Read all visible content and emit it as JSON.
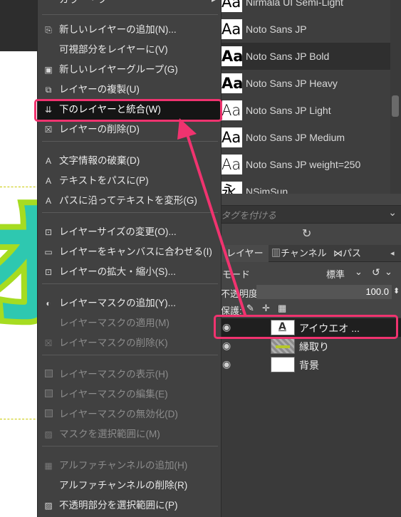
{
  "menu": {
    "top_partial_label": "カラー・フー",
    "items": [
      {
        "icon": "new-layer-icon",
        "glyph": "⎘",
        "label": "新しいレイヤーの追加(N)...",
        "disabled": false
      },
      {
        "icon": "",
        "glyph": "",
        "label": "可視部分をレイヤーに(V)",
        "disabled": false
      },
      {
        "icon": "new-layer-group-icon",
        "glyph": "▣",
        "label": "新しいレイヤーグループ(G)",
        "disabled": false
      },
      {
        "icon": "duplicate-layer-icon",
        "glyph": "⧉",
        "label": "レイヤーの複製(U)",
        "disabled": false
      },
      {
        "icon": "merge-down-icon",
        "glyph": "⇊",
        "label": "下のレイヤーと統合(W)",
        "disabled": false,
        "highlighted": true
      },
      {
        "icon": "delete-layer-icon",
        "glyph": "☒",
        "label": "レイヤーの削除(D)",
        "disabled": false
      },
      {
        "icon": "text-icon",
        "glyph": "A",
        "label": "文字情報の破棄(D)",
        "disabled": false
      },
      {
        "icon": "text-icon",
        "glyph": "A",
        "label": "テキストをパスに(P)",
        "disabled": false
      },
      {
        "icon": "text-icon",
        "glyph": "A",
        "label": "パスに沿ってテキストを変形(G)",
        "disabled": false
      },
      {
        "icon": "layer-size-icon",
        "glyph": "⊡",
        "label": "レイヤーサイズの変更(O)...",
        "disabled": false
      },
      {
        "icon": "fit-canvas-icon",
        "glyph": "▭",
        "label": "レイヤーをキャンバスに合わせる(I)",
        "disabled": false
      },
      {
        "icon": "scale-layer-icon",
        "glyph": "⊡",
        "label": "レイヤーの拡大・縮小(S)...",
        "disabled": false
      },
      {
        "icon": "add-mask-icon",
        "glyph": "◐",
        "label": "レイヤーマスクの追加(Y)...",
        "disabled": false
      },
      {
        "icon": "",
        "glyph": "",
        "label": "レイヤーマスクの適用(M)",
        "disabled": true
      },
      {
        "icon": "delete-mask-icon",
        "glyph": "☒",
        "label": "レイヤーマスクの削除(K)",
        "disabled": true
      },
      {
        "icon": "checkbox-icon",
        "glyph": "■",
        "label": "レイヤーマスクの表示(H)",
        "disabled": true
      },
      {
        "icon": "checkbox-icon",
        "glyph": "■",
        "label": "レイヤーマスクの編集(E)",
        "disabled": true
      },
      {
        "icon": "checkbox-icon",
        "glyph": "■",
        "label": "レイヤーマスクの無効化(D)",
        "disabled": true
      },
      {
        "icon": "mask-to-selection-icon",
        "glyph": "▨",
        "label": "マスクを選択範囲に(M)",
        "disabled": true
      },
      {
        "icon": "add-alpha-icon",
        "glyph": "▦",
        "label": "アルファチャンネルの追加(H)",
        "disabled": true
      },
      {
        "icon": "",
        "glyph": "",
        "label": "アルファチャンネルの削除(R)",
        "disabled": false
      },
      {
        "icon": "alpha-to-selection-icon",
        "glyph": "▨",
        "label": "不透明部分を選択範囲に(P)",
        "disabled": false
      }
    ]
  },
  "fonts": {
    "items": [
      {
        "preview": "Aa",
        "name": "Nirmala UI Semi-Light"
      },
      {
        "preview": "Aa",
        "name": "Noto Sans JP"
      },
      {
        "preview": "Aa",
        "name": "Noto Sans JP Bold"
      },
      {
        "preview": "Aa",
        "name": "Noto Sans JP Heavy"
      },
      {
        "preview": "Aa",
        "name": "Noto Sans JP Light"
      },
      {
        "preview": "Aa",
        "name": "Noto Sans JP Medium"
      },
      {
        "preview": "Aa",
        "name": "Noto Sans JP weight=250"
      },
      {
        "preview": "永",
        "name": "NSimSun"
      }
    ],
    "selected_index": 2
  },
  "tag_input": {
    "placeholder": "タグを付ける"
  },
  "dock_tabs": {
    "layers": "レイヤー",
    "channels": "チャンネル",
    "paths": "パス"
  },
  "layers_panel": {
    "mode_label": "モード",
    "mode_value": "標準",
    "opacity_label": "不透明度",
    "opacity_value": "100.0",
    "lock_label": "保護:",
    "layers": [
      {
        "name": "アイウエオ ...",
        "active": true
      },
      {
        "name": "縁取り",
        "active": false
      },
      {
        "name": "背景",
        "active": false
      }
    ]
  },
  "canvas": {
    "glyph": "オ"
  },
  "colors": {
    "highlight": "#f0336f",
    "menu_bg": "#414141",
    "menu_highlight": "#151515",
    "canvas_fill": "#2ec8b0",
    "canvas_stroke": "#a6dc21"
  }
}
